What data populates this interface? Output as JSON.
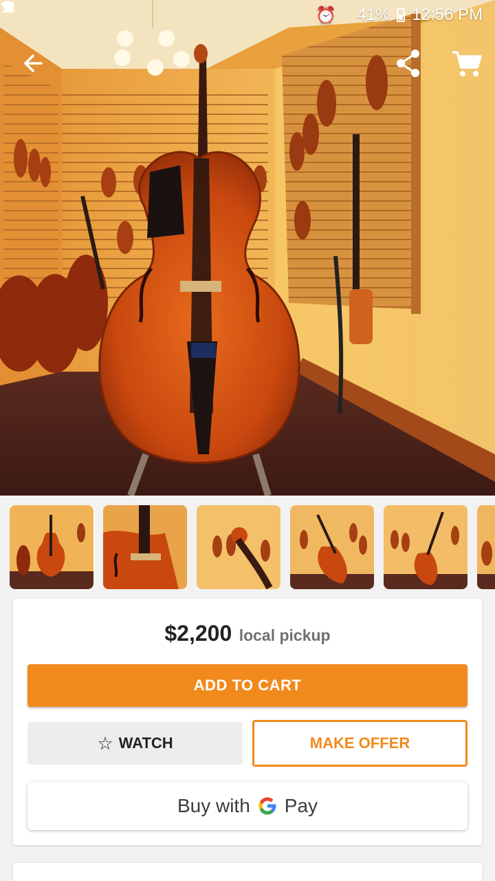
{
  "status_bar": {
    "battery": "41%",
    "time": "12:56 PM"
  },
  "app_bar": {
    "back_icon": "arrow-back-icon",
    "share_icon": "share-icon",
    "cart_icon": "shopping-cart-icon"
  },
  "gallery": {
    "thumbnail_count": 6,
    "selected_index": 0
  },
  "listing": {
    "price": "$2,200",
    "delivery": "local pickup"
  },
  "actions": {
    "add_to_cart": "ADD TO CART",
    "watch": "WATCH",
    "watch_icon": "star-outline-icon",
    "make_offer": "MAKE OFFER",
    "buy_with": "Buy with",
    "pay": "Pay"
  },
  "colors": {
    "accent": "#f18a1c",
    "google_blue": "#4285F4",
    "google_red": "#EA4335",
    "google_yellow": "#FBBC05",
    "google_green": "#34A853"
  }
}
